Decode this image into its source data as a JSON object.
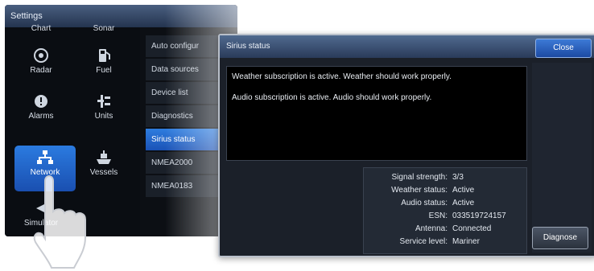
{
  "settings": {
    "title": "Settings",
    "icons": [
      {
        "label": "Chart",
        "icon": "chart-icon"
      },
      {
        "label": "Sonar",
        "icon": "sonar-icon"
      },
      {
        "label": "Radar",
        "icon": "radar-icon"
      },
      {
        "label": "Fuel",
        "icon": "fuel-icon"
      },
      {
        "label": "Alarms",
        "icon": "alarm-icon"
      },
      {
        "label": "Units",
        "icon": "units-icon"
      },
      {
        "label": "Network",
        "icon": "network-icon",
        "selected": true
      },
      {
        "label": "Vessels",
        "icon": "vessels-icon"
      },
      {
        "label": "Simulator",
        "icon": "simulator-icon"
      }
    ],
    "menu": [
      {
        "label": "Auto configur"
      },
      {
        "label": "Data sources"
      },
      {
        "label": "Device list"
      },
      {
        "label": "Diagnostics"
      },
      {
        "label": "Sirius status",
        "active": true
      },
      {
        "label": "NMEA2000"
      },
      {
        "label": "NMEA0183"
      }
    ]
  },
  "dialog": {
    "title": "Sirius status",
    "close_label": "Close",
    "messages": [
      "Weather subscription is active. Weather should work properly.",
      "Audio subscription is active. Audio should work properly."
    ],
    "info": [
      {
        "key": "Signal strength:",
        "value": "3/3"
      },
      {
        "key": "Weather status:",
        "value": "Active"
      },
      {
        "key": "Audio status:",
        "value": "Active"
      },
      {
        "key": "ESN:",
        "value": "033519724157"
      },
      {
        "key": "Antenna:",
        "value": "Connected"
      },
      {
        "key": "Service level:",
        "value": "Mariner"
      }
    ],
    "diagnose_label": "Diagnose"
  },
  "colors": {
    "accent": "#2b7be0",
    "dialog_bg": "#1b2029",
    "message_bg": "#000000"
  }
}
